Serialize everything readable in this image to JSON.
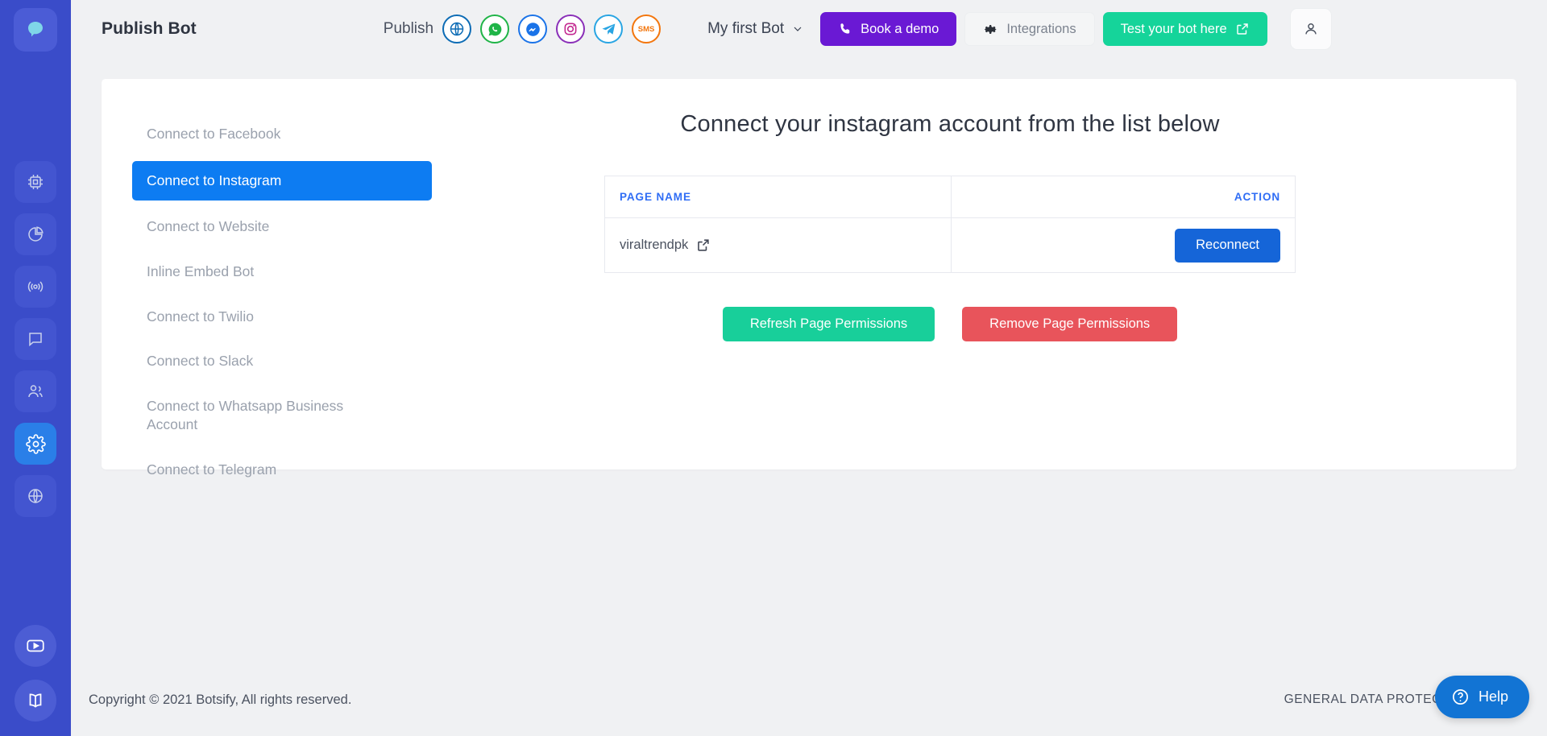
{
  "header": {
    "brand_title": "Publish Bot",
    "publish_label": "Publish",
    "channels": [
      {
        "name": "website-icon",
        "label": "Website",
        "color": "#0d6cb5"
      },
      {
        "name": "whatsapp-icon",
        "label": "WhatsApp",
        "color": "#1fb447"
      },
      {
        "name": "messenger-icon",
        "label": "Messenger",
        "color": "#1a73e8"
      },
      {
        "name": "instagram-icon",
        "label": "Instagram",
        "color": "#8a2fb8"
      },
      {
        "name": "telegram-icon",
        "label": "Telegram",
        "color": "#29a5e3"
      },
      {
        "name": "sms-icon",
        "label": "SMS",
        "color": "#f3760d"
      }
    ],
    "bot_selector": "My first Bot",
    "book_demo": "Book a demo",
    "integrations": "Integrations",
    "test_bot": "Test your bot here"
  },
  "rail": {
    "items": [
      {
        "icon": "chip-icon",
        "active": false
      },
      {
        "icon": "pie-chart-icon",
        "active": false
      },
      {
        "icon": "broadcast-icon",
        "active": false
      },
      {
        "icon": "chat-bubble-icon",
        "active": false
      },
      {
        "icon": "users-icon",
        "active": false
      },
      {
        "icon": "gear-icon",
        "active": true
      },
      {
        "icon": "globe-icon",
        "active": false
      }
    ],
    "bottom": [
      {
        "icon": "video-play-icon"
      },
      {
        "icon": "book-icon"
      }
    ]
  },
  "menu": {
    "items": [
      {
        "label": "Connect to Facebook",
        "active": false
      },
      {
        "label": "Connect to Instagram",
        "active": true
      },
      {
        "label": "Connect to Website",
        "active": false
      },
      {
        "label": "Inline Embed Bot",
        "active": false
      },
      {
        "label": "Connect to Twilio",
        "active": false
      },
      {
        "label": "Connect to Slack",
        "active": false
      },
      {
        "label": "Connect to Whatsapp Business Account",
        "active": false
      },
      {
        "label": "Connect to Telegram",
        "active": false
      }
    ]
  },
  "panel": {
    "title": "Connect your instagram account from the list below",
    "table": {
      "columns": [
        "PAGE NAME",
        "ACTION"
      ],
      "rows": [
        {
          "page_name": "viraltrendpk",
          "action_label": "Reconnect"
        }
      ]
    },
    "buttons": {
      "refresh": "Refresh Page Permissions",
      "remove": "Remove Page Permissions"
    }
  },
  "footer": {
    "copyright": "Copyright © 2021 Botsify, All rights reserved.",
    "gdpr": "GENERAL DATA PROTECTION REGU"
  },
  "help": {
    "label": "Help"
  },
  "colors": {
    "rail_bg": "#3a4cc9",
    "accent_blue": "#0d7cf2",
    "purple": "#6a19d4",
    "green": "#15d49a",
    "red": "#e8545b",
    "table_header_blue": "#2f6df5",
    "reconnect_blue": "#1565d8"
  }
}
